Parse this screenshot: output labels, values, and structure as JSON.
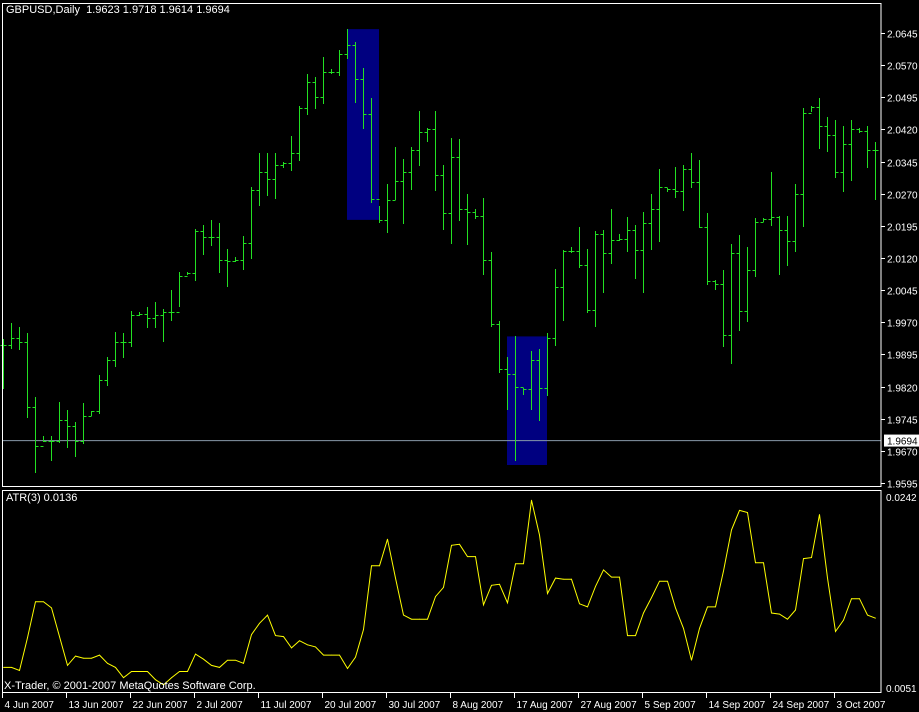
{
  "chart_data": [
    {
      "type": "ohlc",
      "symbol": "GBPUSD,Daily",
      "header_values": "1.9623 1.9718 1.9614 1.9694",
      "bar_color": "#22e022",
      "bar_fields": [
        "high",
        "low",
        "close"
      ],
      "bars": [
        [
          1.993,
          1.9816,
          1.9918
        ],
        [
          1.9969,
          1.9911,
          1.9934
        ],
        [
          1.9958,
          1.9907,
          1.9925
        ],
        [
          1.9944,
          1.9749,
          1.9772
        ],
        [
          1.9795,
          1.9621,
          1.9681
        ],
        [
          1.9705,
          1.9693,
          1.9693
        ],
        [
          1.9705,
          1.9649,
          1.9693
        ],
        [
          1.9784,
          1.9691,
          1.9742
        ],
        [
          1.9765,
          1.9679,
          1.9728
        ],
        [
          1.9737,
          1.9658,
          1.9693
        ],
        [
          1.9781,
          1.9688,
          1.9751
        ],
        [
          1.9763,
          1.9753,
          1.9763
        ],
        [
          1.9846,
          1.9758,
          1.9835
        ],
        [
          1.989,
          1.9823,
          1.9883
        ],
        [
          1.9948,
          1.9869,
          1.9925
        ],
        [
          1.9944,
          1.9888,
          1.9925
        ],
        [
          1.9997,
          1.9914,
          1.9988
        ],
        [
          1.9993,
          1.9986,
          1.999
        ],
        [
          2.0006,
          1.9958,
          1.9981
        ],
        [
          2.0018,
          1.9958,
          1.9986
        ],
        [
          2.0002,
          1.9927,
          1.9993
        ],
        [
          2.0046,
          1.9976,
          1.9993
        ],
        [
          2.0088,
          2.0009,
          2.0078
        ],
        [
          2.0088,
          2.0083,
          2.0085
        ],
        [
          2.0188,
          2.0069,
          2.0183
        ],
        [
          2.0197,
          2.013,
          2.0169
        ],
        [
          2.0208,
          2.015,
          2.0169
        ],
        [
          2.0201,
          2.0088,
          2.0116
        ],
        [
          2.0141,
          2.0055,
          2.0113
        ],
        [
          2.0123,
          2.0113,
          2.0116
        ],
        [
          2.0171,
          2.0095,
          2.0155
        ],
        [
          2.0285,
          2.012,
          2.0278
        ],
        [
          2.0364,
          2.0243,
          2.032
        ],
        [
          2.0364,
          2.0267,
          2.0304
        ],
        [
          2.0366,
          2.026,
          2.0338
        ],
        [
          2.0343,
          2.0332,
          2.0341
        ],
        [
          2.0404,
          2.0325,
          2.0364
        ],
        [
          2.0475,
          2.0348,
          2.0469
        ],
        [
          2.055,
          2.0457,
          2.0531
        ],
        [
          2.0543,
          2.0471,
          2.0496
        ],
        [
          2.0589,
          2.0482,
          2.0554
        ],
        [
          2.0561,
          2.0552,
          2.0554
        ],
        [
          2.0606,
          2.0547,
          2.0596
        ],
        [
          2.0654,
          2.0587,
          2.0617
        ],
        [
          2.0624,
          2.0485,
          2.0538
        ],
        [
          2.0564,
          2.0424,
          2.0455
        ],
        [
          2.0494,
          2.025,
          2.0257
        ],
        [
          2.0241,
          2.0204,
          2.0208
        ],
        [
          2.0292,
          2.0181,
          2.0255
        ],
        [
          2.0378,
          2.0257,
          2.0299
        ],
        [
          2.035,
          2.0201,
          2.032
        ],
        [
          2.0378,
          2.028,
          2.0371
        ],
        [
          2.0464,
          2.0336,
          2.0415
        ],
        [
          2.0424,
          2.0392,
          2.0422
        ],
        [
          2.0464,
          2.0278,
          2.0313
        ],
        [
          2.0338,
          2.0188,
          2.0225
        ],
        [
          2.0399,
          2.0155,
          2.0355
        ],
        [
          2.0397,
          2.0208,
          2.0234
        ],
        [
          2.0269,
          2.0153,
          2.0227
        ],
        [
          2.0234,
          2.0213,
          2.0218
        ],
        [
          2.026,
          2.0083,
          2.0116
        ],
        [
          2.0134,
          1.9962,
          1.9967
        ],
        [
          1.9972,
          1.9853,
          1.9862
        ],
        [
          1.989,
          1.9767,
          1.9849
        ],
        [
          1.9937,
          1.9649,
          1.9818
        ],
        [
          1.9816,
          1.9802,
          1.9814
        ],
        [
          1.9902,
          1.9767,
          1.9881
        ],
        [
          1.9907,
          1.9742,
          1.9816
        ],
        [
          1.9944,
          1.98,
          1.9934
        ],
        [
          2.0095,
          1.9916,
          2.0053
        ],
        [
          2.0139,
          1.9976,
          2.0136
        ],
        [
          2.0146,
          2.0134,
          2.0136
        ],
        [
          2.0192,
          2.0099,
          2.0104
        ],
        [
          2.0141,
          1.9993,
          1.9999
        ],
        [
          2.0183,
          1.9962,
          2.0176
        ],
        [
          2.0185,
          2.0041,
          2.0132
        ],
        [
          2.0234,
          2.0109,
          2.0162
        ],
        [
          2.0176,
          2.0162,
          2.0164
        ],
        [
          2.0215,
          2.0136,
          2.0185
        ],
        [
          2.0197,
          2.0074,
          2.0139
        ],
        [
          2.0227,
          2.0041,
          2.0201
        ],
        [
          2.0269,
          2.0141,
          2.0234
        ],
        [
          2.0327,
          2.016,
          2.0285
        ],
        [
          2.0283,
          2.0276,
          2.028
        ],
        [
          2.0332,
          2.0262,
          2.0276
        ],
        [
          2.0336,
          2.0232,
          2.0327
        ],
        [
          2.0366,
          2.0285,
          2.0297
        ],
        [
          2.0348,
          2.0192,
          2.0192
        ],
        [
          2.0225,
          2.006,
          2.0067
        ],
        [
          2.0069,
          2.0048,
          2.006
        ],
        [
          2.0092,
          1.9914,
          1.9941
        ],
        [
          2.0153,
          1.9876,
          2.0132
        ],
        [
          2.0174,
          1.9951,
          1.9997
        ],
        [
          2.0146,
          1.9972,
          2.0092
        ],
        [
          2.0213,
          2.0078,
          2.0204
        ],
        [
          2.0213,
          2.0206,
          2.0211
        ],
        [
          2.032,
          2.0197,
          2.0215
        ],
        [
          2.0218,
          2.0083,
          2.0185
        ],
        [
          2.0218,
          2.0104,
          2.016
        ],
        [
          2.0292,
          2.0136,
          2.0269
        ],
        [
          2.0469,
          2.0195,
          2.0459
        ],
        [
          2.0475,
          2.0464,
          2.0473
        ],
        [
          2.0494,
          2.0376,
          2.0429
        ],
        [
          2.045,
          2.0369,
          2.0408
        ],
        [
          2.0443,
          2.0308,
          2.032
        ],
        [
          2.0429,
          2.0276,
          2.0387
        ],
        [
          2.0443,
          2.0301,
          2.0422
        ],
        [
          2.0424,
          2.0413,
          2.0417
        ],
        [
          2.0429,
          2.0332,
          2.0373
        ],
        [
          2.039,
          2.0257,
          2.0373
        ]
      ],
      "ylim": [
        1.9595,
        2.0645
      ],
      "y_ticks": [
        "2.0645",
        "2.0570",
        "2.0495",
        "2.0420",
        "2.0345",
        "2.0270",
        "2.0195",
        "2.0120",
        "2.0045",
        "1.9970",
        "1.9895",
        "1.9820",
        "1.9745",
        "1.9670",
        "1.9595"
      ],
      "current_price": "1.9694",
      "current_price_line_color": "#8899aa",
      "highlights": [
        {
          "start_bar": 43,
          "end_bar": 47,
          "top": 2.0654,
          "bottom": 2.0209,
          "color": "#000080"
        },
        {
          "start_bar": 63,
          "end_bar": 68,
          "top": 1.9937,
          "bottom": 1.9637,
          "color": "#000080"
        }
      ],
      "x_tick_every_bars": 8,
      "x_ticks": [
        "4 Jun 2007",
        "13 Jun 2007",
        "22 Jun 2007",
        "2 Jul 2007",
        "11 Jul 2007",
        "20 Jul 2007",
        "30 Jul 2007",
        "8 Aug 2007",
        "17 Aug 2007",
        "27 Aug 2007",
        "5 Sep 2007",
        "14 Sep 2007",
        "24 Sep 2007",
        "3 Oct 2007"
      ]
    },
    {
      "type": "line",
      "title": "ATR(3) 0.0136",
      "color": "#ffff00",
      "ylim": [
        0.0051,
        0.0242
      ],
      "y_ticks": [
        "0.0242",
        "0.0051"
      ],
      "values": [
        0.0073,
        0.0073,
        0.007,
        0.0102,
        0.0137,
        0.0137,
        0.0131,
        0.0103,
        0.0075,
        0.0084,
        0.0082,
        0.0082,
        0.0085,
        0.0077,
        0.0073,
        0.0063,
        0.0069,
        0.0069,
        0.0069,
        0.0061,
        0.0056,
        0.0063,
        0.0069,
        0.0069,
        0.0086,
        0.0081,
        0.0075,
        0.0073,
        0.008,
        0.008,
        0.0077,
        0.0105,
        0.0116,
        0.0124,
        0.0104,
        0.0103,
        0.0092,
        0.0099,
        0.0095,
        0.0093,
        0.0085,
        0.0085,
        0.0085,
        0.0072,
        0.0083,
        0.011,
        0.0172,
        0.0172,
        0.0198,
        0.016,
        0.0124,
        0.012,
        0.012,
        0.012,
        0.0142,
        0.0151,
        0.0192,
        0.0193,
        0.0181,
        0.0181,
        0.0134,
        0.0153,
        0.0154,
        0.0136,
        0.0174,
        0.0174,
        0.0236,
        0.0202,
        0.0145,
        0.016,
        0.0159,
        0.0159,
        0.0135,
        0.0132,
        0.0152,
        0.0168,
        0.0161,
        0.0161,
        0.0104,
        0.0104,
        0.0126,
        0.0141,
        0.0157,
        0.0157,
        0.0131,
        0.0111,
        0.008,
        0.0111,
        0.0132,
        0.0132,
        0.0167,
        0.0207,
        0.0226,
        0.0224,
        0.0175,
        0.0175,
        0.0126,
        0.0125,
        0.012,
        0.0129,
        0.0179,
        0.018,
        0.0222,
        0.016,
        0.0108,
        0.0119,
        0.014,
        0.014,
        0.0124,
        0.0121
      ]
    }
  ],
  "footer": {
    "copyright": "X-Trader, © 2001-2007 MetaQuotes Software Corp."
  }
}
